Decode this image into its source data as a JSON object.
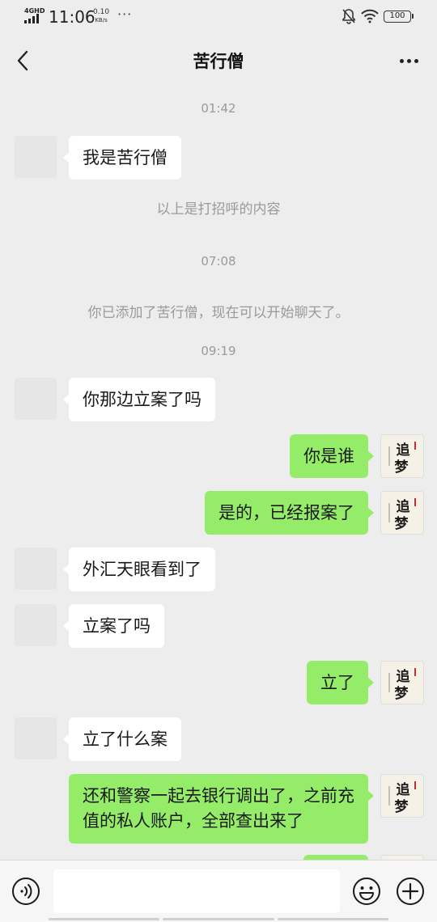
{
  "status_bar": {
    "network": "4GHD",
    "time": "11:06",
    "speed_value": "0.10",
    "speed_unit": "KB/s",
    "dots": "···",
    "battery": "100"
  },
  "header": {
    "title": "苦行僧",
    "back_icon": "chevron-left-icon",
    "more_icon": "more-dots-icon"
  },
  "chat": {
    "items": [
      {
        "kind": "timestamp",
        "text": "01:42"
      },
      {
        "kind": "message",
        "side": "in",
        "text": "我是苦行僧"
      },
      {
        "kind": "system",
        "text": "以上是打招呼的内容"
      },
      {
        "kind": "timestamp",
        "text": "07:08"
      },
      {
        "kind": "system",
        "text": "你已添加了苦行僧，现在可以开始聊天了。"
      },
      {
        "kind": "timestamp",
        "text": "09:19"
      },
      {
        "kind": "message",
        "side": "in",
        "text": "你那边立案了吗"
      },
      {
        "kind": "message",
        "side": "out",
        "text": "你是谁"
      },
      {
        "kind": "message",
        "side": "out",
        "text": "是的，已经报案了"
      },
      {
        "kind": "message",
        "side": "in",
        "text": "外汇天眼看到了"
      },
      {
        "kind": "message",
        "side": "in",
        "text": "立案了吗"
      },
      {
        "kind": "message",
        "side": "out",
        "text": "立了"
      },
      {
        "kind": "message",
        "side": "in",
        "text": "立了什么案"
      },
      {
        "kind": "message",
        "side": "out",
        "text": "还和警察一起去银行调出了，之前充值的私人账户，全部查出来了"
      }
    ]
  },
  "avatar_right": {
    "calligraphy": "追梦"
  },
  "input_bar": {
    "placeholder": "",
    "voice_icon": "voice-icon",
    "emoji_icon": "emoji-icon",
    "plus_icon": "plus-icon"
  },
  "colors": {
    "background": "#ededed",
    "bubble_out": "#95ec69",
    "bubble_in": "#ffffff",
    "meta_text": "#9a9a9a"
  }
}
